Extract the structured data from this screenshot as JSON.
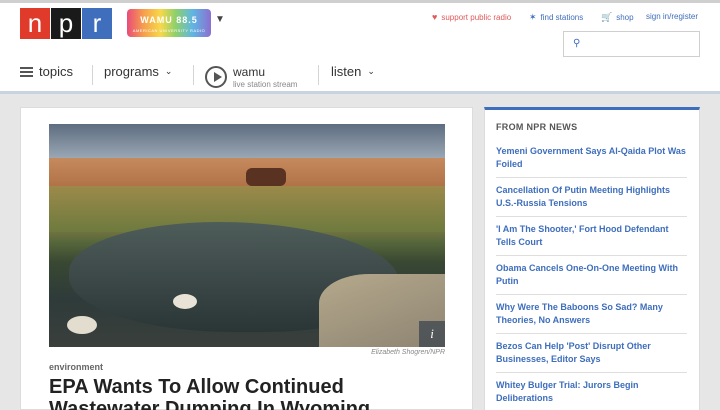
{
  "header": {
    "logo_letters": [
      "n",
      "p",
      "r"
    ],
    "station_logo": {
      "name": "WAMU 88.5",
      "tagline": "AMERICAN UNIVERSITY RADIO"
    },
    "support_label": "support public radio",
    "find_label": "find stations",
    "shop_label": "shop",
    "signin_label": "sign in/register",
    "search_placeholder": ""
  },
  "nav": {
    "topics_label": "topics",
    "programs_label": "programs",
    "station_name": "wamu",
    "station_sub": "live station stream",
    "listen_label": "listen"
  },
  "story": {
    "photo_credit": "Elizabeth Shogren/NPR",
    "info_label": "i",
    "slug": "environment",
    "headline": "EPA Wants To Allow Continued Wastewater Dumping In Wyoming"
  },
  "sidebar": {
    "title": "FROM NPR NEWS",
    "items": [
      {
        "label": "Yemeni Government Says Al-Qaida Plot Was Foiled"
      },
      {
        "label": "Cancellation Of Putin Meeting Highlights U.S.-Russia Tensions"
      },
      {
        "label": "'I Am The Shooter,' Fort Hood Defendant Tells Court"
      },
      {
        "label": "Obama Cancels One-On-One Meeting With Putin"
      },
      {
        "label": "Why Were The Baboons So Sad? Many Theories, No Answers"
      },
      {
        "label": "Bezos Can Help 'Post' Disrupt Other Businesses, Editor Says"
      },
      {
        "label": "Whitey Bulger Trial: Jurors Begin Deliberations"
      }
    ]
  },
  "colors": {
    "accent": "#3e6ebc",
    "npr_red": "#e03a2b",
    "npr_blue": "#3e6ebc",
    "support": "#e05a5a"
  }
}
